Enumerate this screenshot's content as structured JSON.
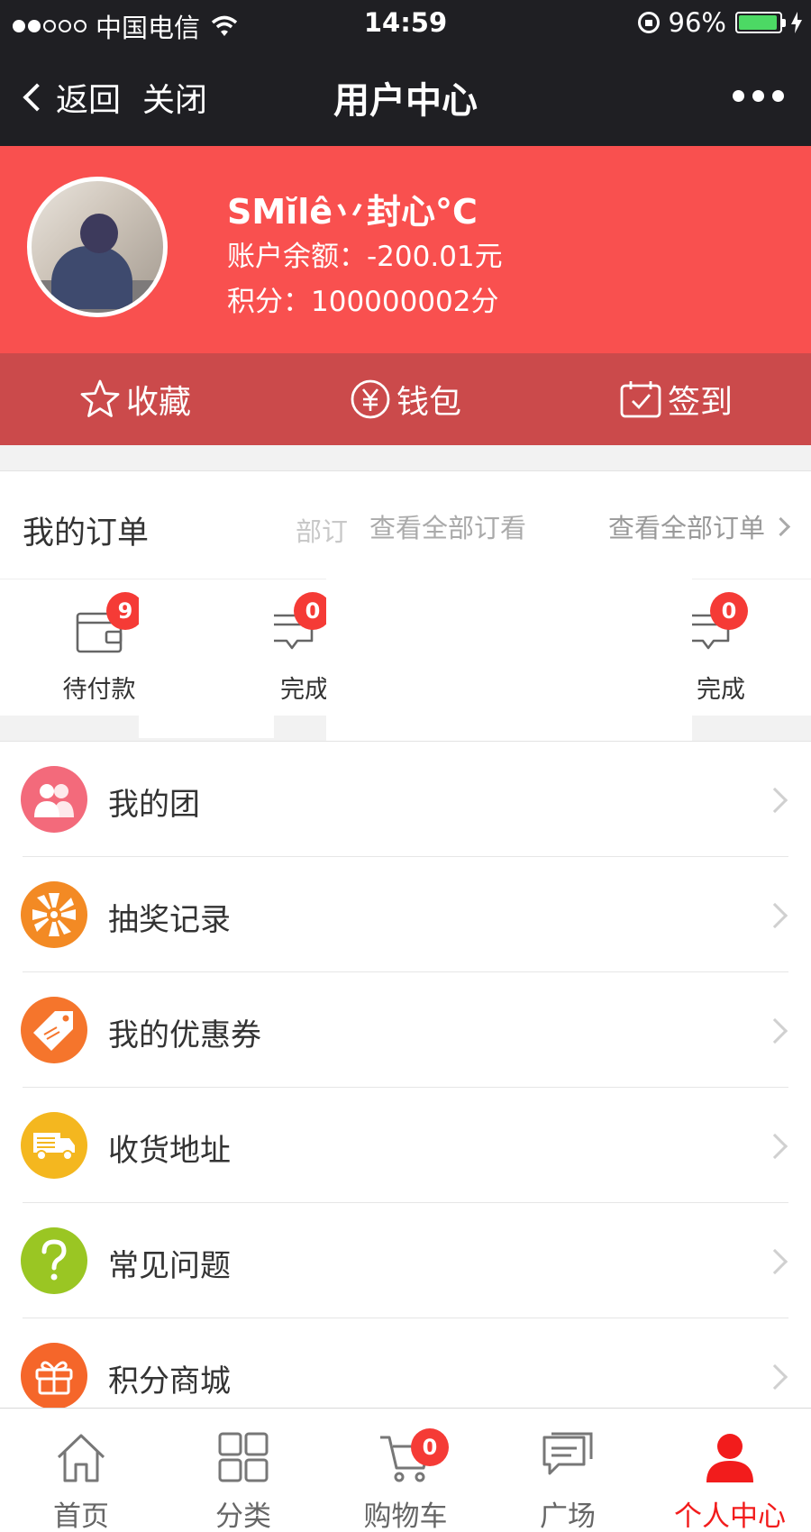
{
  "status_bar": {
    "carrier": "中国电信",
    "time": "14:59",
    "battery_percent": "96%",
    "battery_level": 0.96
  },
  "nav": {
    "back_label": "返回",
    "close_label": "关闭",
    "title": "用户中心"
  },
  "profile": {
    "name": "SMĭlê丷封心°C",
    "balance": "账户余额：-200.01元",
    "points": "积分：100000002分"
  },
  "quick_actions": [
    {
      "label": "收藏",
      "icon": "star-icon"
    },
    {
      "label": "钱包",
      "icon": "yen-icon"
    },
    {
      "label": "签到",
      "icon": "calendar-check-icon"
    }
  ],
  "orders": {
    "title": "我的订单",
    "ghost_text_1": "部订",
    "ghost_text_2": "查看全部订看",
    "view_all": "查看全部订单",
    "items": [
      {
        "label": "待付款",
        "badge": "9",
        "icon": "wallet-icon"
      },
      {
        "label": "完成",
        "badge": "0",
        "icon": "message-icon"
      },
      {
        "label": "完成",
        "badge": "0",
        "icon": "message-icon"
      }
    ]
  },
  "menu": [
    {
      "label": "我的团",
      "icon": "group-icon",
      "color": "#f36a7b"
    },
    {
      "label": "抽奖记录",
      "icon": "wheel-icon",
      "color": "#f38a24"
    },
    {
      "label": "我的优惠券",
      "icon": "coupon-tag-icon",
      "color": "#f5752c"
    },
    {
      "label": "收货地址",
      "icon": "truck-icon",
      "color": "#f4b71f"
    },
    {
      "label": "常见问题",
      "icon": "question-icon",
      "color": "#9ac623"
    },
    {
      "label": "积分商城",
      "icon": "gift-icon",
      "color": "#f5662a"
    }
  ],
  "tabbar": {
    "items": [
      {
        "label": "首页",
        "icon": "home-icon"
      },
      {
        "label": "分类",
        "icon": "grid-icon"
      },
      {
        "label": "购物车",
        "icon": "cart-icon",
        "badge": "0"
      },
      {
        "label": "广场",
        "icon": "chat-icon"
      },
      {
        "label": "个人中心",
        "icon": "user-icon"
      }
    ],
    "active_index": 4,
    "active_color": "#f21c1c"
  },
  "colors": {
    "header_red": "#f9504f",
    "action_bar_red": "#cb4a4b",
    "badge_red": "#f53b36",
    "dark_bar": "#1f1f23"
  }
}
